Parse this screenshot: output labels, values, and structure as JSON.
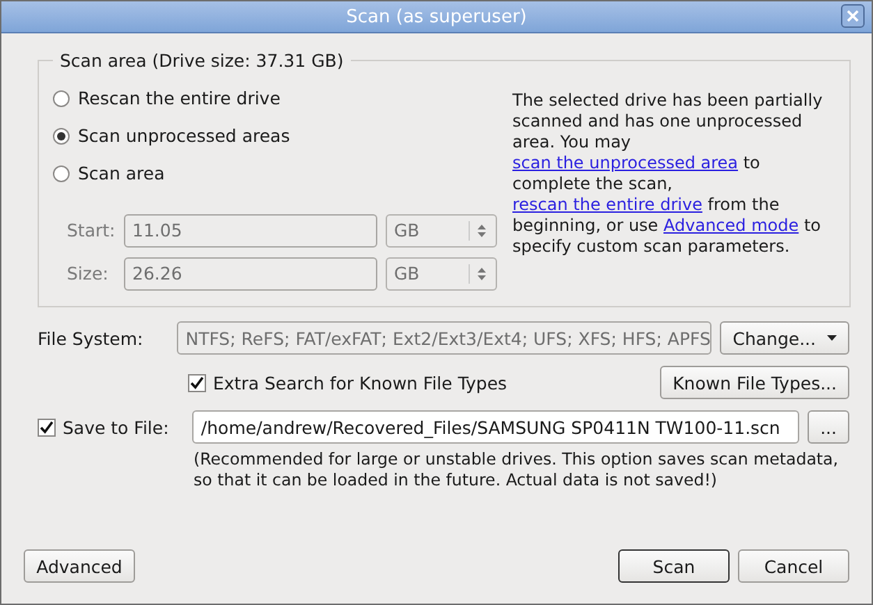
{
  "window": {
    "title": "Scan (as superuser)"
  },
  "scan_area": {
    "title": "Scan area (Drive size: 37.31 GB)",
    "options": [
      {
        "label": "Rescan the entire drive",
        "selected": false
      },
      {
        "label": "Scan unprocessed areas",
        "selected": true
      },
      {
        "label": "Scan area",
        "selected": false
      }
    ],
    "fields": [
      {
        "label": "Start:",
        "value": "11.05",
        "unit": "GB",
        "disabled": true
      },
      {
        "label": "Size:",
        "value": "26.26",
        "unit": "GB",
        "disabled": true
      }
    ],
    "description": [
      {
        "kind": "text",
        "text": "The selected drive has been partially scanned and has one unprocessed area. You may "
      },
      {
        "kind": "link",
        "text": "scan the unprocessed area"
      },
      {
        "kind": "text",
        "text": " to complete the scan, "
      },
      {
        "kind": "link",
        "text": "rescan the entire drive"
      },
      {
        "kind": "text",
        "text": " from the beginning, or use "
      },
      {
        "kind": "link",
        "text": "Advanced mode"
      },
      {
        "kind": "text",
        "text": " to specify custom scan parameters."
      }
    ]
  },
  "file_system": {
    "label": "File System:",
    "value": "NTFS; ReFS; FAT/exFAT; Ext2/Ext3/Ext4; UFS; XFS; HFS; APFS",
    "button": "Change..."
  },
  "extra_search": {
    "label": "Extra Search for Known File Types",
    "checked": true,
    "button": "Known File Types..."
  },
  "save_to_file": {
    "label": "Save to File:",
    "checked": true,
    "value": "/home/andrew/Recovered_Files/SAMSUNG SP0411N TW100-11.scn",
    "browse": "...",
    "note": "(Recommended for large or unstable drives. This option saves scan metadata, so that it can be loaded in the future. Actual data is not saved!)"
  },
  "buttons": {
    "advanced": "Advanced",
    "scan": "Scan",
    "cancel": "Cancel"
  }
}
